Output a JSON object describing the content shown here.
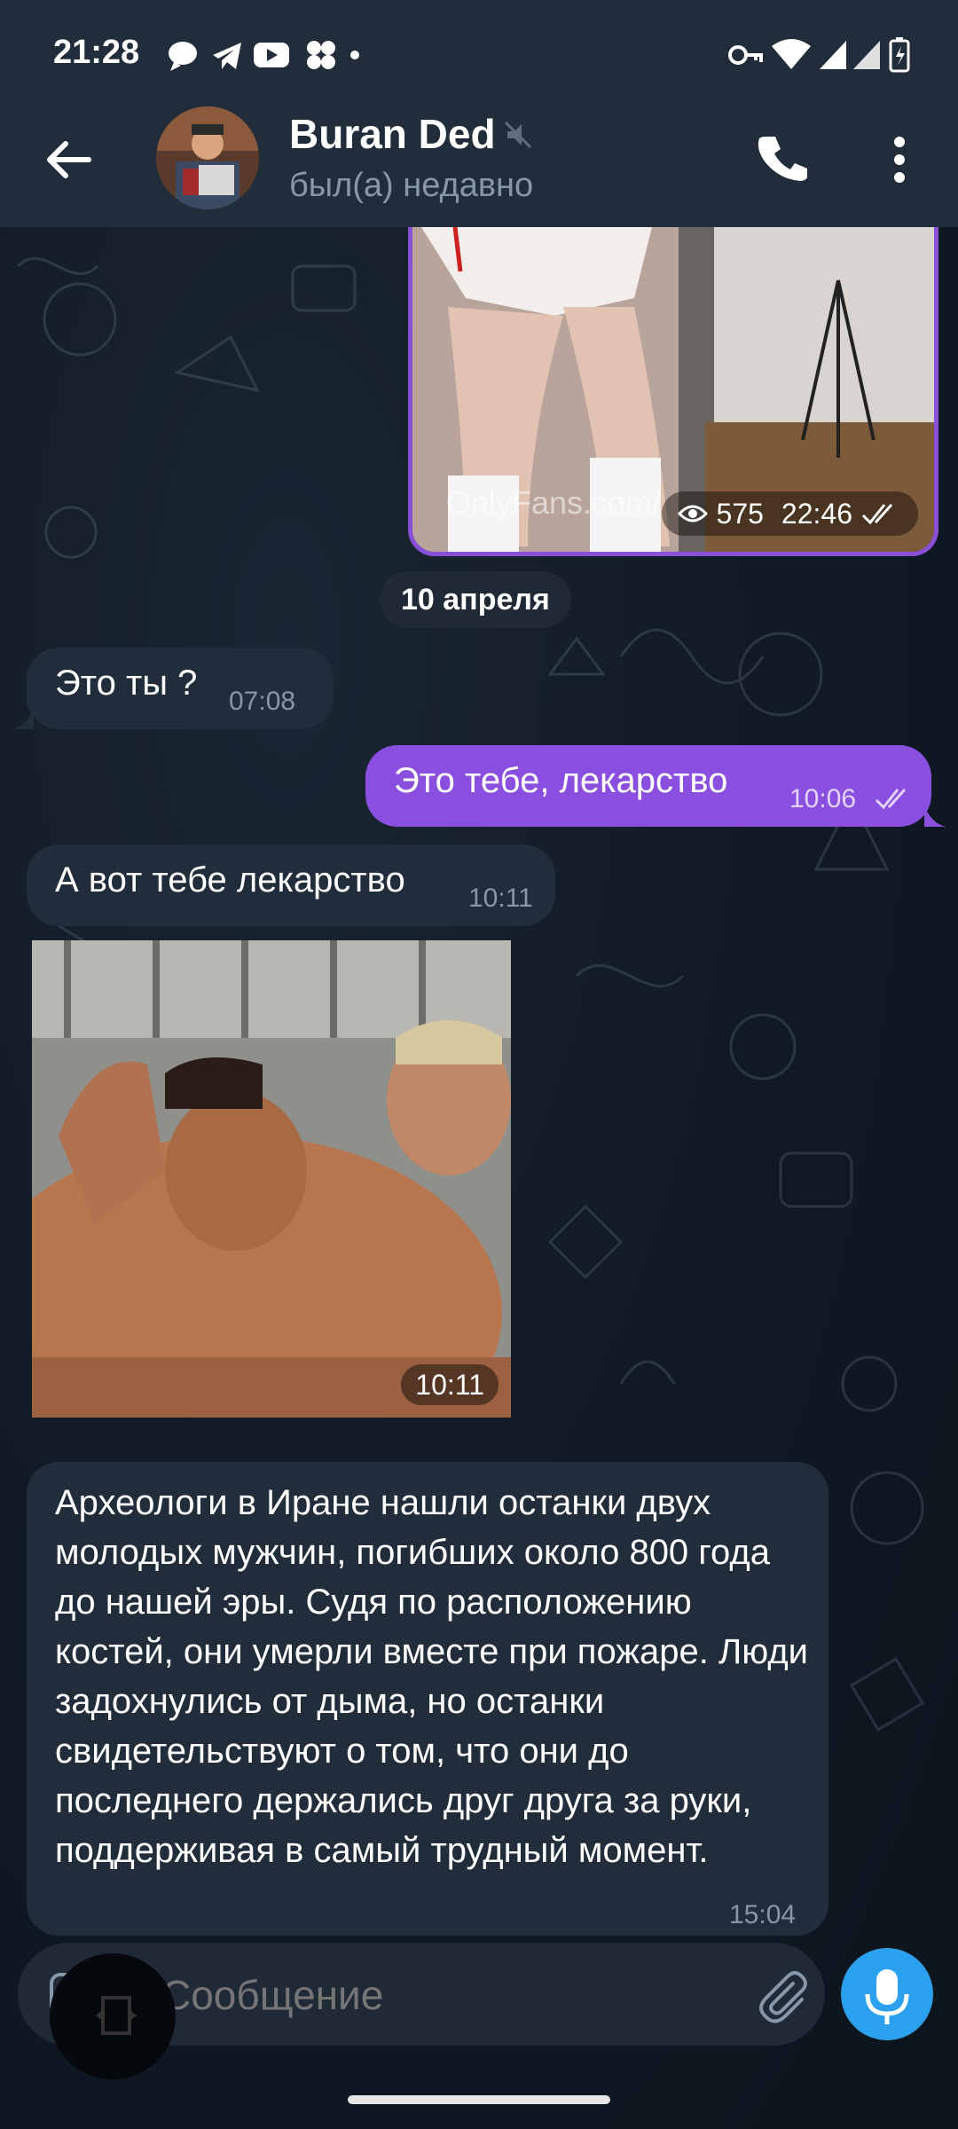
{
  "status_bar": {
    "time": "21:28",
    "left_icons": [
      "chat-bubble-icon",
      "telegram-icon",
      "youtube-icon",
      "dots-app-icon",
      "dot-icon"
    ],
    "right_icons": [
      "key-icon",
      "wifi-icon",
      "signal-icon",
      "signal-icon",
      "battery-icon"
    ]
  },
  "header": {
    "title": "Buran Ded",
    "status": "был(а) недавно",
    "muted": true
  },
  "top_media": {
    "watermark": "OnlyFans.com/",
    "views": "575",
    "time": "22:46"
  },
  "date_chip": "10 апреля",
  "messages": [
    {
      "direction": "in",
      "text": "Это ты ?",
      "time": "07:08"
    },
    {
      "direction": "out",
      "text": "Это тебе, лекарство",
      "time": "10:06",
      "read": true
    },
    {
      "direction": "in",
      "text": "А вот тебе лекарство",
      "time": "10:11"
    },
    {
      "direction": "in",
      "type": "photo",
      "time": "10:11"
    },
    {
      "direction": "in",
      "text": "Археологи в Иране нашли останки двух молодых мужчин, погибших около 800 года до нашей эры. Судя по расположению костей, они умерли вместе при пожаре. Люди задохнулись от дыма, но останки свидетельствуют о том, что они до последнего держались друг друга за руки, поддерживая в самый трудный момент.",
      "time": "15:04"
    }
  ],
  "composer": {
    "placeholder": "Сообщение"
  },
  "colors": {
    "header_bg": "#212d3b",
    "incoming_bubble": "#212d3b",
    "outgoing_bubble": "#8a4fdf",
    "mic_button": "#2aa0ee",
    "muted_text": "#8597a8"
  }
}
